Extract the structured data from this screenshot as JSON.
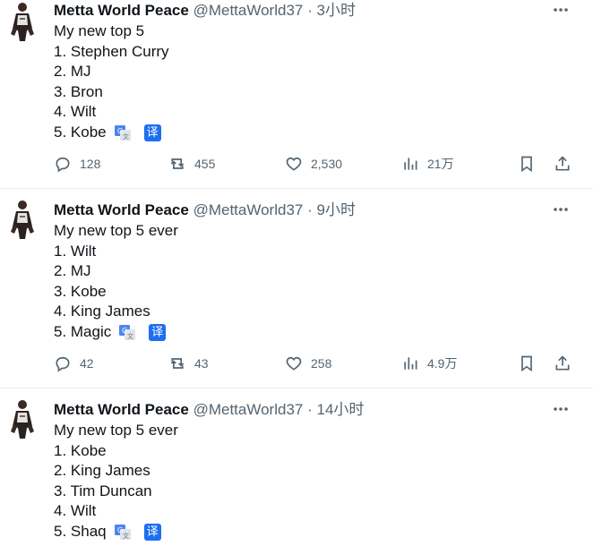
{
  "tweets": [
    {
      "name": "Metta World Peace",
      "handle": "@MettaWorld37",
      "sep": "·",
      "time": "3小时",
      "lines": [
        "My new top 5",
        "1. Stephen Curry",
        "2. MJ",
        "3. Bron",
        "4. Wilt",
        "5. Kobe"
      ],
      "translate_badge": "译",
      "replies": "128",
      "reposts": "455",
      "likes": "2,530",
      "views": "21万"
    },
    {
      "name": "Metta World Peace",
      "handle": "@MettaWorld37",
      "sep": "·",
      "time": "9小时",
      "lines": [
        "My new top 5 ever",
        "1. Wilt",
        "2. MJ",
        "3. Kobe",
        "4. King James",
        "5. Magic"
      ],
      "translate_badge": "译",
      "replies": "42",
      "reposts": "43",
      "likes": "258",
      "views": "4.9万"
    },
    {
      "name": "Metta World Peace",
      "handle": "@MettaWorld37",
      "sep": "·",
      "time": "14小时",
      "lines": [
        "My new top 5 ever",
        "1. Kobe",
        "2. King James",
        "3. Tim Duncan",
        "4. Wilt",
        "5. Shaq"
      ],
      "translate_badge": "译"
    }
  ],
  "icons": {
    "more": "more-horizontal-icon",
    "reply": "reply-icon",
    "repost": "repost-icon",
    "like": "heart-icon",
    "views": "views-chart-icon",
    "bookmark": "bookmark-icon",
    "share": "share-icon",
    "google_translate": "google-translate-icon"
  },
  "colors": {
    "text": "#0f1419",
    "muted": "#536471",
    "translate_blue": "#1d6ff2",
    "divider": "#e6ecf0"
  }
}
